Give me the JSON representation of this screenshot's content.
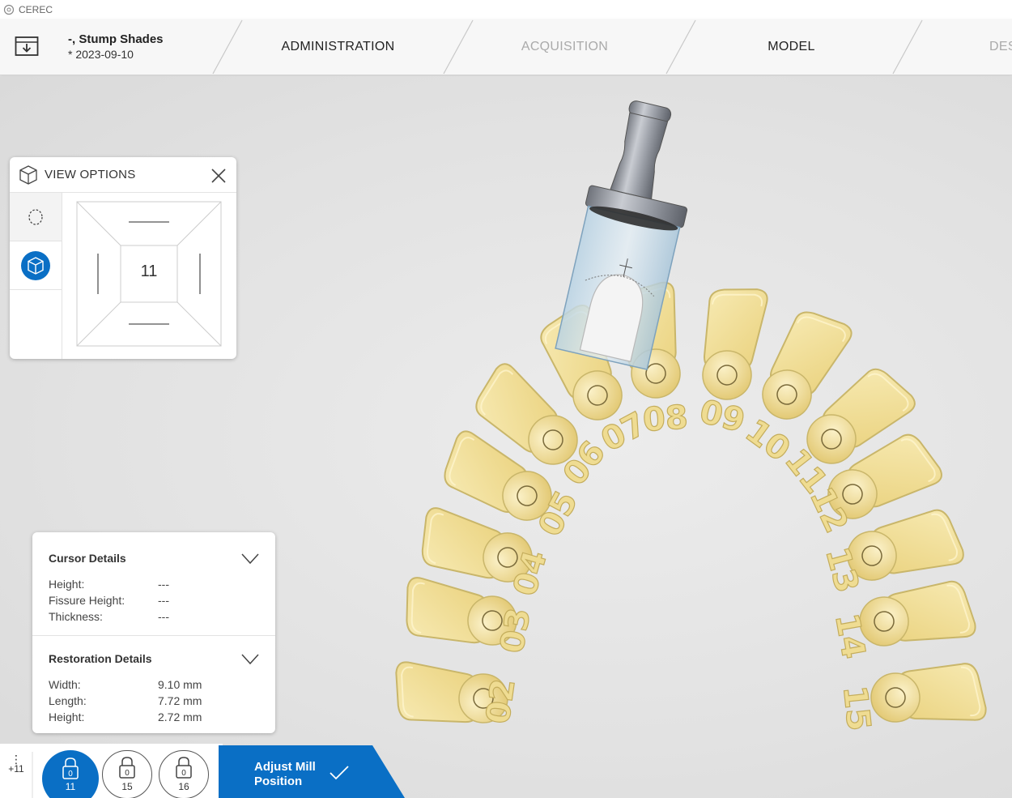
{
  "titlebar": {
    "app_name": "CEREC"
  },
  "header": {
    "case_title": "-, Stump Shades",
    "case_date": "* 2023-09-10",
    "steps": [
      {
        "label": "ADMINISTRATION",
        "state": "active"
      },
      {
        "label": "ACQUISITION",
        "state": "disabled"
      },
      {
        "label": "MODEL",
        "state": "active"
      },
      {
        "label": "DES",
        "state": "disabled"
      }
    ]
  },
  "view_options": {
    "title": "VIEW OPTIONS",
    "cube_label": "11",
    "side_items": [
      "jaw-outline-icon",
      "cube-3d-icon"
    ],
    "selected_side_item": 1
  },
  "cursor_details": {
    "title": "Cursor Details",
    "rows": [
      {
        "label": "Height:",
        "value": "---"
      },
      {
        "label": "Fissure Height:",
        "value": "---"
      },
      {
        "label": "Thickness:",
        "value": "---"
      }
    ]
  },
  "restoration_details": {
    "title": "Restoration Details",
    "rows": [
      {
        "label": "Width:",
        "value": "9.10 mm"
      },
      {
        "label": "Length:",
        "value": "7.72 mm"
      },
      {
        "label": "Height:",
        "value": "2.72 mm"
      }
    ]
  },
  "bottom_bar": {
    "more_count": "+11",
    "teeth": [
      {
        "lock_count": "0",
        "number": "11",
        "active": true
      },
      {
        "lock_count": "0",
        "number": "15",
        "active": false
      },
      {
        "lock_count": "0",
        "number": "16",
        "active": false
      }
    ],
    "action": {
      "line1": "Adjust Mill",
      "line2": "Position"
    }
  },
  "scene": {
    "tooth_labels": [
      "02",
      "03",
      "04",
      "05",
      "06",
      "07",
      "08",
      "09",
      "10",
      "11",
      "12",
      "13",
      "14",
      "15"
    ]
  },
  "colors": {
    "accent": "#0a6fc5",
    "tooth_fill": "#f3e3a0",
    "tooth_stroke": "#c9b66a",
    "background": "#e4e4e4"
  }
}
